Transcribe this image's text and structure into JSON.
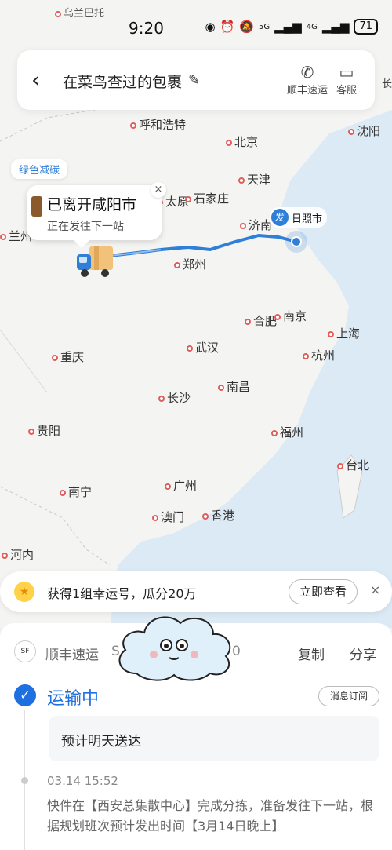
{
  "status_bar": {
    "time": "9:20",
    "net1": "5G",
    "net2": "4G",
    "battery": "71"
  },
  "header": {
    "title": "在菜鸟查过的包裹",
    "actions": [
      {
        "label": "顺丰速运",
        "icon": "phone-icon"
      },
      {
        "label": "客服",
        "icon": "chat-icon"
      }
    ],
    "right_peek": "长"
  },
  "map": {
    "green_badge": "绿色减碳",
    "bubble_title": "已离开咸阳市",
    "bubble_sub": "正在发往下一站",
    "origin_badge": "发",
    "origin_label": "日照市",
    "cities": [
      {
        "name": "乌兰巴托"
      },
      {
        "name": "呼和浩特"
      },
      {
        "name": "沈阳"
      },
      {
        "name": "北京"
      },
      {
        "name": "天津"
      },
      {
        "name": "太原"
      },
      {
        "name": "石家庄"
      },
      {
        "name": "济南"
      },
      {
        "name": "兰州"
      },
      {
        "name": "郑州"
      },
      {
        "name": "合肥"
      },
      {
        "name": "南京"
      },
      {
        "name": "上海"
      },
      {
        "name": "武汉"
      },
      {
        "name": "杭州"
      },
      {
        "name": "重庆"
      },
      {
        "name": "长沙"
      },
      {
        "name": "南昌"
      },
      {
        "name": "贵阳"
      },
      {
        "name": "福州"
      },
      {
        "name": "台北"
      },
      {
        "name": "南宁"
      },
      {
        "name": "广州"
      },
      {
        "name": "澳门"
      },
      {
        "name": "香港"
      },
      {
        "name": "河内"
      }
    ]
  },
  "promo": {
    "text": "获得1组幸运号，瓜分20万",
    "button": "立即查看",
    "close": "×"
  },
  "sheet": {
    "carrier": "顺丰速运",
    "tracking_left": "S",
    "tracking_right": "0",
    "copy": "复制",
    "share": "分享",
    "status": "运输中",
    "subscribe": "消息订阅",
    "eta": "预计明天送达",
    "event_time": "03.14 15:52",
    "event_desc": "快件在【西安总集散中心】完成分拣，准备发往下一站，根据规划班次预计发出时间【3月14日晚上】"
  }
}
